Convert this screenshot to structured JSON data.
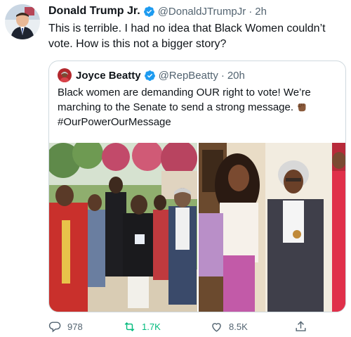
{
  "tweet": {
    "author_name": "Donald Trump Jr.",
    "author_handle": "@DonaldJTrumpJr",
    "separator": "·",
    "time": "2h",
    "text": "This is terrible. I had no idea that Black Women couldn’t vote. How is this not a bigger story?"
  },
  "quoted": {
    "author_name": "Joyce Beatty",
    "author_handle": "@RepBeatty",
    "separator": "·",
    "time": "20h",
    "text_line1": "Black women are demanding OUR right to vote! We’re",
    "text_line2": "marching to the Senate to send a strong message.",
    "hashtag": "#OurPowerOurMessage",
    "emoji": "raised-fist-medium-dark-skin"
  },
  "actions": {
    "replies": "978",
    "retweets": "1.7K",
    "likes": "8.5K"
  },
  "colors": {
    "verified": "#1d9bf0",
    "retweet_active": "#00ba7c",
    "secondary_text": "#536471",
    "border": "#cfd9de"
  }
}
